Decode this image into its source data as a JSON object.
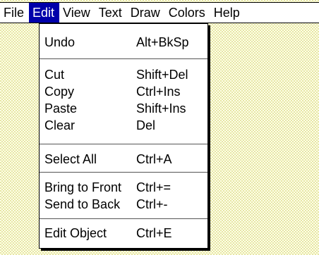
{
  "menubar": {
    "items": [
      {
        "label": "File"
      },
      {
        "label": "Edit"
      },
      {
        "label": "View"
      },
      {
        "label": "Text"
      },
      {
        "label": "Draw"
      },
      {
        "label": "Colors"
      },
      {
        "label": "Help"
      }
    ]
  },
  "edit_menu": {
    "undo": {
      "label": "Undo",
      "shortcut": "Alt+BkSp"
    },
    "cut": {
      "label": "Cut",
      "shortcut": "Shift+Del"
    },
    "copy": {
      "label": "Copy",
      "shortcut": "Ctrl+Ins"
    },
    "paste": {
      "label": "Paste",
      "shortcut": "Shift+Ins"
    },
    "clear": {
      "label": "Clear",
      "shortcut": "Del"
    },
    "select_all": {
      "label": "Select All",
      "shortcut": "Ctrl+A"
    },
    "bring_to_front": {
      "label": "Bring to Front",
      "shortcut": "Ctrl+="
    },
    "send_to_back": {
      "label": "Send to Back",
      "shortcut": "Ctrl+-"
    },
    "edit_object": {
      "label": "Edit Object",
      "shortcut": "Ctrl+E"
    }
  },
  "colors": {
    "active_menu_bg": "#0000aa",
    "active_menu_text": "#ffffff",
    "desktop_pattern": "#e6e6a6"
  }
}
